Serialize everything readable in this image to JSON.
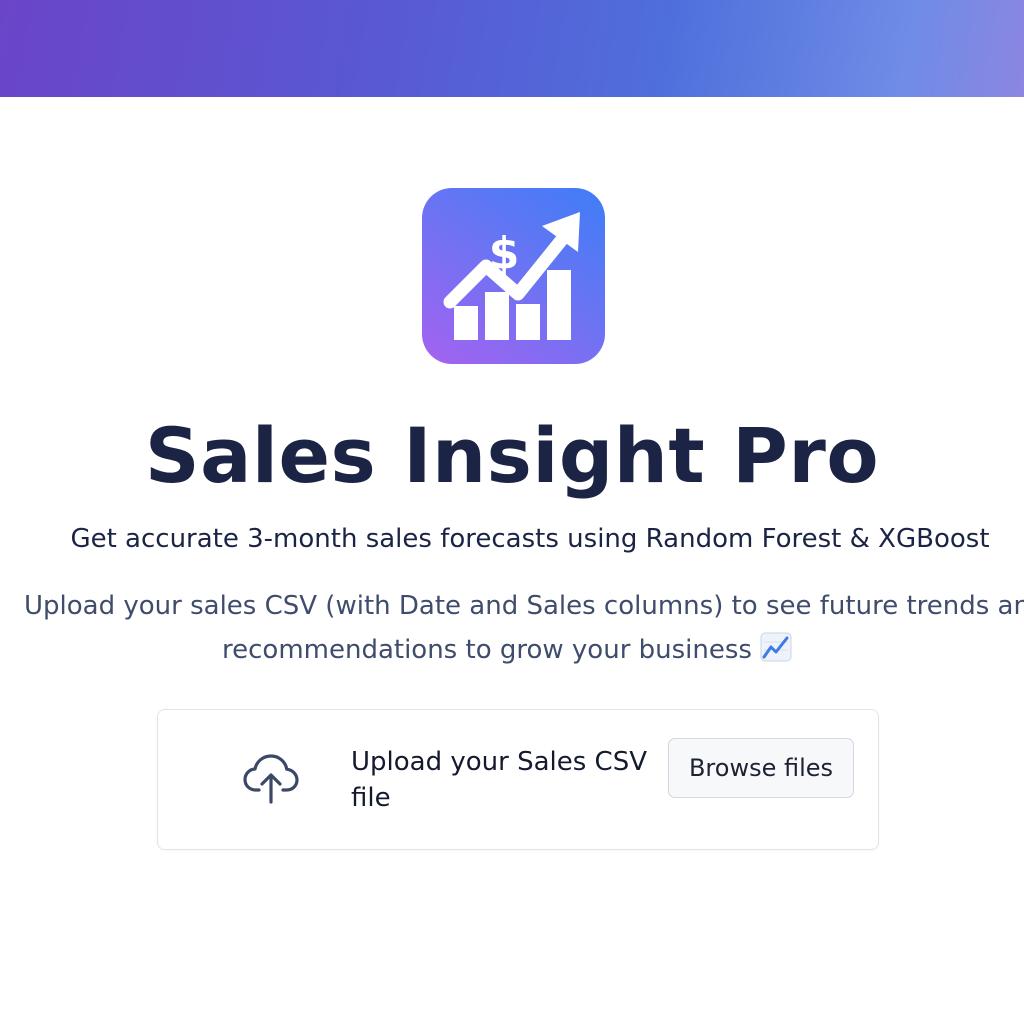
{
  "app": {
    "title": "Sales Insight Pro",
    "subtitle": "Get accurate 3-month sales forecasts using Random Forest & XGBoost",
    "description_line1": "Upload your sales CSV (with Date and Sales columns) to see future trends and",
    "description_line2": "recommendations to grow your business"
  },
  "logo": {
    "icon": "sales-growth-dollar-chart-icon"
  },
  "uploader": {
    "label": "Upload your Sales CSV file",
    "button_label": "Browse files",
    "icon": "cloud-upload-icon"
  },
  "colors": {
    "banner_gradient_start": "#6a45c8",
    "banner_gradient_end": "#8b86e2",
    "logo_gradient_top": "#3f7df7",
    "logo_gradient_bottom": "#a562f0",
    "title_text": "#1c2445"
  }
}
